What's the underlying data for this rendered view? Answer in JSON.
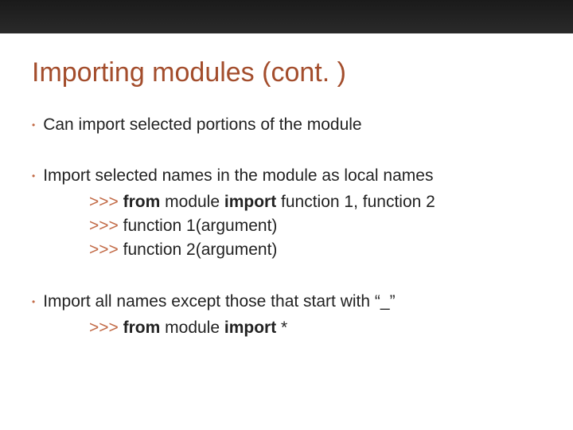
{
  "title": "Importing modules (cont. )",
  "bullets": {
    "b1": {
      "text": "Can import selected portions of the module"
    },
    "b2": {
      "text": "Import selected names in the module as local names",
      "code": {
        "l1": {
          "prompt": ">>> ",
          "kw1": "from",
          "t1": " module ",
          "kw2": "import",
          "t2": " function 1, function 2"
        },
        "l2": {
          "prompt": ">>> ",
          "t": "function 1(argument)"
        },
        "l3": {
          "prompt": ">>> ",
          "t": "function 2(argument)"
        }
      }
    },
    "b3": {
      "text": "Import all names except those that start with “_”",
      "code": {
        "l1": {
          "prompt": ">>> ",
          "kw1": "from",
          "t1": " module ",
          "kw2": "import",
          "t2": " *"
        }
      }
    }
  }
}
